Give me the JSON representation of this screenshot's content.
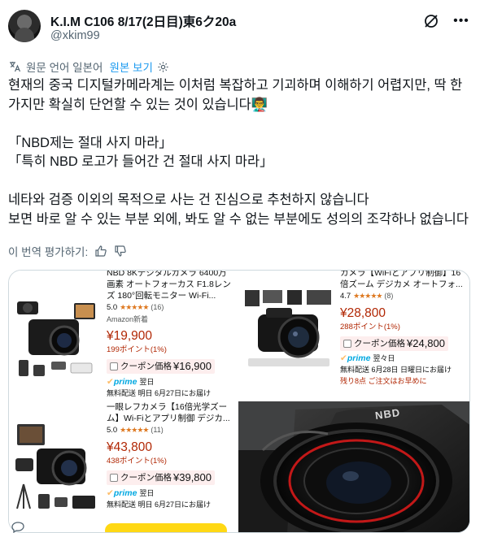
{
  "header": {
    "display_name": "K.I.M C106 8/17(2日目)東6ク20a",
    "handle": "@xkim99",
    "icons": [
      "grok-icon",
      "more-icon"
    ]
  },
  "translation": {
    "label": "원문 언어 일본어",
    "link": "원본 보기",
    "icon": "translate-icon",
    "settings_icon": "gear-icon"
  },
  "post": {
    "text": "현재의 중국 디지털카메라계는 이처럼 복잡하고 기괴하며 이해하기 어렵지만, 딱 한 가지만 확실히 단언할 수 있는 것이 있습니다👨‍🏫\n\n「NBD제는 절대 사지 마라」\n「특히 NBD 로고가 들어간 건 절대 사지 마라」\n\n네타와 검증 이외의 목적으로 사는 건 진심으로 추천하지 않습니다\n보면 바로 알 수 있는 부분 외에, 봐도 알 수 없는 부분에도 성의의 조각하나 없습니다"
  },
  "rate": {
    "label": "이 번역 평가하기:",
    "icons": [
      "thumbs-up-icon",
      "thumbs-down-icon"
    ]
  },
  "media": {
    "products": [
      {
        "title": "NBD 8Kデジタルカメラ 6400万画素 オートフォーカス F1.8レンズ 180°回転モニター Wi-Fi...",
        "rating": "5.0",
        "stars": "★★★★★",
        "reviews": "(16)",
        "badge": "Amazon新着",
        "price": "¥19,900",
        "points": "199ポイント(1%)",
        "coupon_label": "クーポン価格",
        "coupon_price": "¥16,900",
        "prime": "prime",
        "prime_day": "翌日",
        "delivery": "無料配送 明日 6月27日にお届け"
      },
      {
        "title": "カメラ【WiFiとアプリ制御】16倍ズーム デジカメ オートフォ...",
        "rating": "4.7",
        "stars": "★★★★★",
        "reviews": "(8)",
        "price": "¥28,800",
        "points": "288ポイント(1%)",
        "coupon_label": "クーポン価格",
        "coupon_price": "¥24,800",
        "prime": "prime",
        "prime_day": "翌々日",
        "delivery": "無料配送 6月28日 日曜日にお届け",
        "stock": "残り8点 ご注文はお早めに"
      },
      {
        "title": "一眼レフカメラ【16倍光学ズーム】Wi-Fiとアプリ制御 デジカ...",
        "rating": "5.0",
        "stars": "★★★★★",
        "reviews": "(11)",
        "price": "¥43,800",
        "points": "438ポイント(1%)",
        "coupon_label": "クーポン価格",
        "coupon_price": "¥39,800",
        "prime": "prime",
        "prime_day": "翌日",
        "delivery": "無料配送 明日 6月27日にお届け"
      }
    ],
    "photo": {
      "logo": "NBD"
    }
  },
  "colors": {
    "accent": "#1d9bf0",
    "secondary_text": "#536471",
    "price": "#b12704",
    "prime": "#00a8e1",
    "stars": "#de7921",
    "cart_button": "#ffd814"
  }
}
